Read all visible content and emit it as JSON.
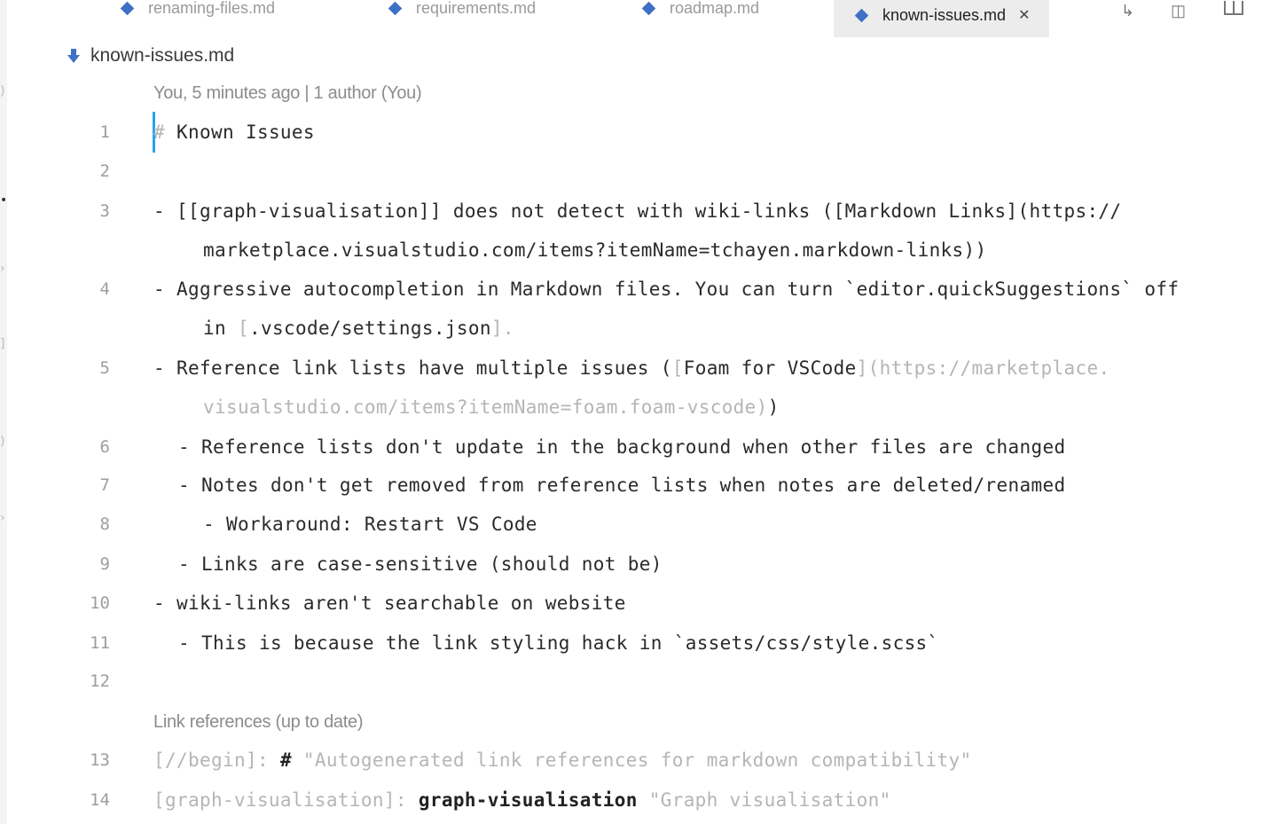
{
  "tabs": [
    {
      "label": "renaming-files.md"
    },
    {
      "label": "requirements.md"
    },
    {
      "label": "roadmap.md"
    },
    {
      "label": "known-issues.md",
      "active": true
    }
  ],
  "breadcrumb": {
    "file": "known-issues.md"
  },
  "codelens": {
    "blame": "You, 5 minutes ago | 1 author (You)",
    "link_refs": "Link references (up to date)"
  },
  "editor": {
    "lines": {
      "l1": {
        "num": "1",
        "hash": "#",
        "text": " Known Issues"
      },
      "l2": {
        "num": "2"
      },
      "l3": {
        "num": "3",
        "text": "- [[graph-visualisation]] does not detect with wiki-links ([Markdown Links](https://",
        "wrap": "marketplace.visualstudio.com/items?itemName=tchayen.markdown-links))"
      },
      "l4": {
        "num": "4",
        "text": "- Aggressive autocompletion in Markdown files. You can turn `editor.quickSuggestions` off",
        "wrap_pre": "in ",
        "wrap_open": "[",
        "wrap_link": ".vscode/settings.json",
        "wrap_close": "].",
        "wrap_end": ""
      },
      "l5": {
        "num": "5",
        "text_pre": "- Reference link lists have multiple issues (",
        "open": "[",
        "link": "Foam for VSCode",
        "url": "](https://marketplace.",
        "wrap_url": "visualstudio.com/items?itemName=foam.foam-vscode)",
        "wrap_end": ")"
      },
      "l6": {
        "num": "6",
        "text": "- Reference lists don't update in the background when other files are changed"
      },
      "l7": {
        "num": "7",
        "text": "- Notes don't get removed from reference lists when notes are deleted/renamed"
      },
      "l8": {
        "num": "8",
        "text": "- Workaround: Restart VS Code"
      },
      "l9": {
        "num": "9",
        "text": "- Links are case-sensitive (should not be)"
      },
      "l10": {
        "num": "10",
        "text": "- wiki-links aren't searchable on website"
      },
      "l11": {
        "num": "11",
        "text": "- This is because the link styling hack in `assets/css/style.scss`"
      },
      "l12": {
        "num": "12"
      },
      "l13": {
        "num": "13",
        "pre": "[//begin]: ",
        "hash": "#",
        "post": " \"Autogenerated link references for markdown compatibility\""
      },
      "l14": {
        "num": "14",
        "pre": "[graph-visualisation]: ",
        "id": "graph-visualisation",
        "post": " \"Graph visualisation\""
      }
    }
  },
  "colors": {
    "accent": "#3f70c7",
    "cursor": "#29a3ee"
  }
}
